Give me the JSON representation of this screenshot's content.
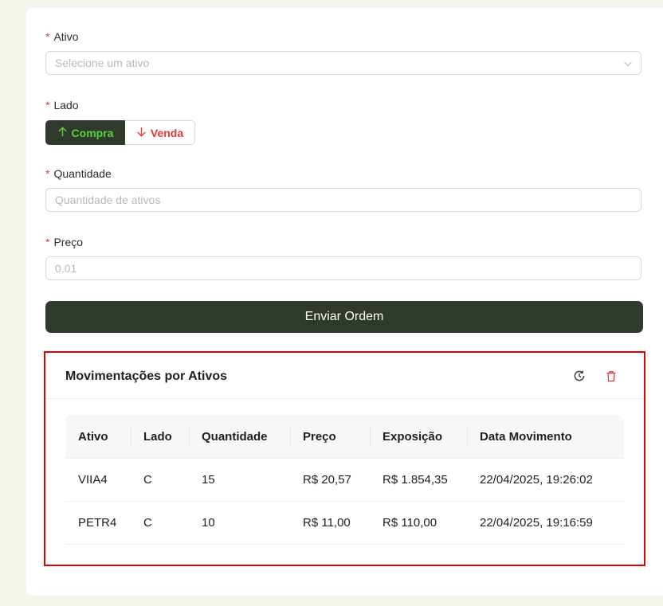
{
  "form": {
    "asset": {
      "label": "Ativo",
      "placeholder": "Selecione um ativo"
    },
    "side": {
      "label": "Lado",
      "buy_label": "Compra",
      "sell_label": "Venda"
    },
    "quantity": {
      "label": "Quantidade",
      "placeholder": "Quantidade de ativos"
    },
    "price": {
      "label": "Preço",
      "placeholder": "0.01"
    },
    "required_mark": "*",
    "submit_label": "Enviar Ordem"
  },
  "movements": {
    "title": "Movimentações por Ativos",
    "columns": [
      "Ativo",
      "Lado",
      "Quantidade",
      "Preço",
      "Exposição",
      "Data Movimento"
    ],
    "rows": [
      [
        "VIIA4",
        "C",
        "15",
        "R$ 20,57",
        "R$ 1.854,35",
        "22/04/2025, 19:26:02"
      ],
      [
        "PETR4",
        "C",
        "10",
        "R$ 11,00",
        "R$ 110,00",
        "22/04/2025, 19:16:59"
      ]
    ]
  },
  "colors": {
    "primary": "#2f3a2d",
    "buy": "#5cd13e",
    "sell": "#e03b3b",
    "highlight_border": "#e00000"
  },
  "icons": [
    "chevron-down-icon",
    "arrow-up-icon",
    "arrow-down-icon",
    "history-icon",
    "trash-icon"
  ]
}
